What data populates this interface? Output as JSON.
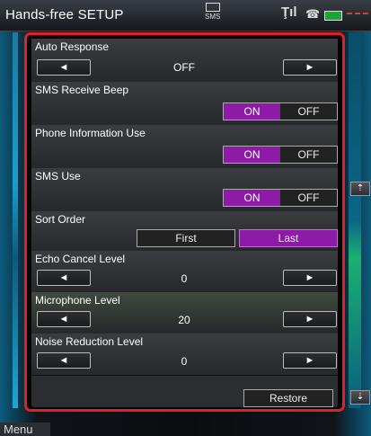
{
  "header": {
    "title": "Hands-free SETUP",
    "sms_label": "SMS"
  },
  "settings": {
    "auto_response": {
      "label": "Auto Response",
      "value": "OFF"
    },
    "sms_receive_beep": {
      "label": "SMS Receive Beep",
      "on": "ON",
      "off": "OFF",
      "selected": "ON"
    },
    "phone_information_use": {
      "label": "Phone Information Use",
      "on": "ON",
      "off": "OFF",
      "selected": "ON"
    },
    "sms_use": {
      "label": "SMS Use",
      "on": "ON",
      "off": "OFF",
      "selected": "ON"
    },
    "sort_order": {
      "label": "Sort Order",
      "first": "First",
      "last": "Last",
      "selected": "Last"
    },
    "echo_cancel_level": {
      "label": "Echo Cancel Level",
      "value": "0"
    },
    "microphone_level": {
      "label": "Microphone Level",
      "value": "20"
    },
    "noise_reduction_level": {
      "label": "Noise Reduction Level",
      "value": "0"
    }
  },
  "arrows": {
    "left": "◄",
    "right": "►"
  },
  "restore_label": "Restore",
  "menu_label": "Menu",
  "colors": {
    "selected": "#8e1aa8",
    "frame": "#e2202a"
  }
}
